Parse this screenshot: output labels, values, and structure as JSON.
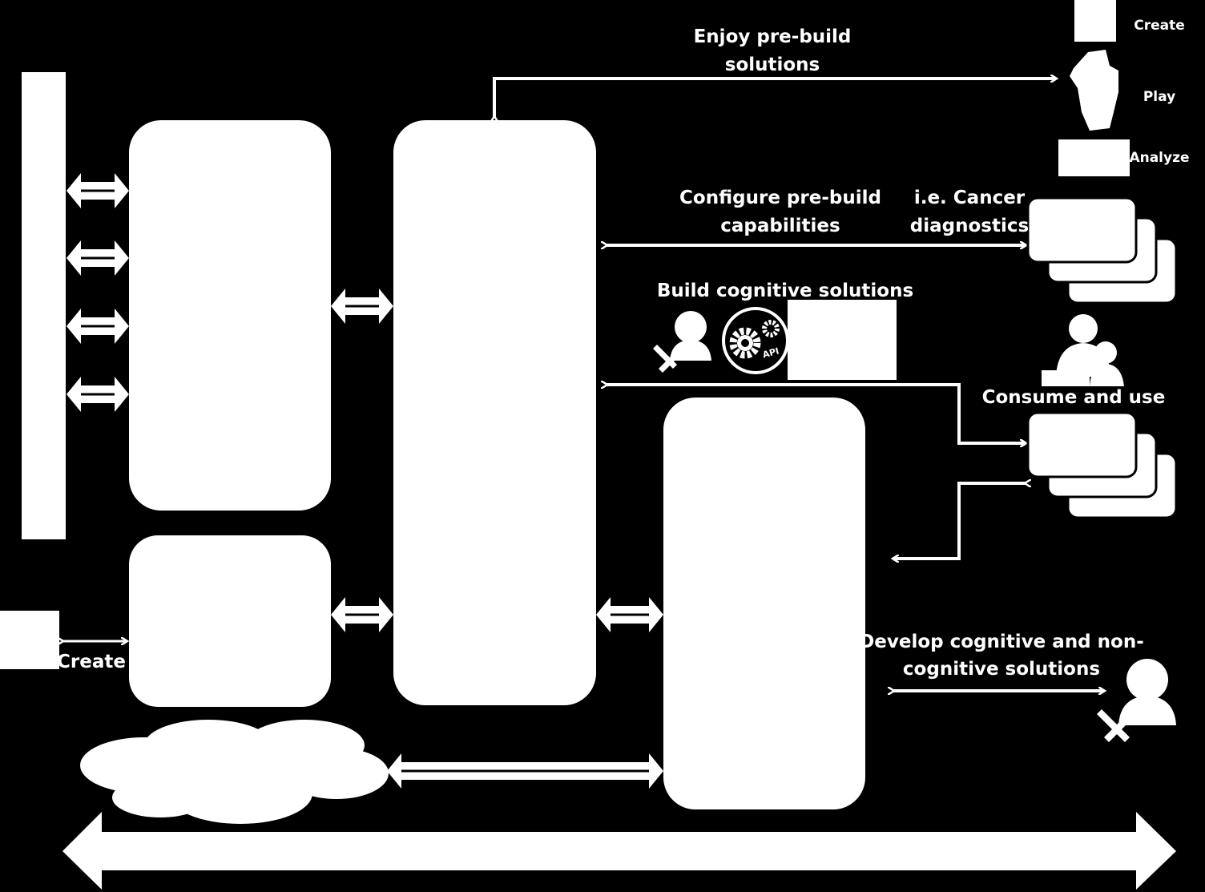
{
  "labels": {
    "enjoy_line1": "Enjoy pre-build",
    "enjoy_line2": "solutions",
    "create_top": "Create",
    "play": "Play",
    "analyze": "Analyze",
    "configure_line1": "Configure pre-build",
    "configure_line2": "capabilities",
    "cancer_line1": "i.e. Cancer",
    "cancer_line2": "diagnostics",
    "build": "Build cognitive solutions",
    "api": "API",
    "consume": "Consume and use",
    "develop_line1": "Develop cognitive and non-",
    "develop_line2": "cognitive solutions",
    "create_left": "Create"
  },
  "colors": {
    "background": "#000000",
    "foreground": "#ffffff"
  }
}
